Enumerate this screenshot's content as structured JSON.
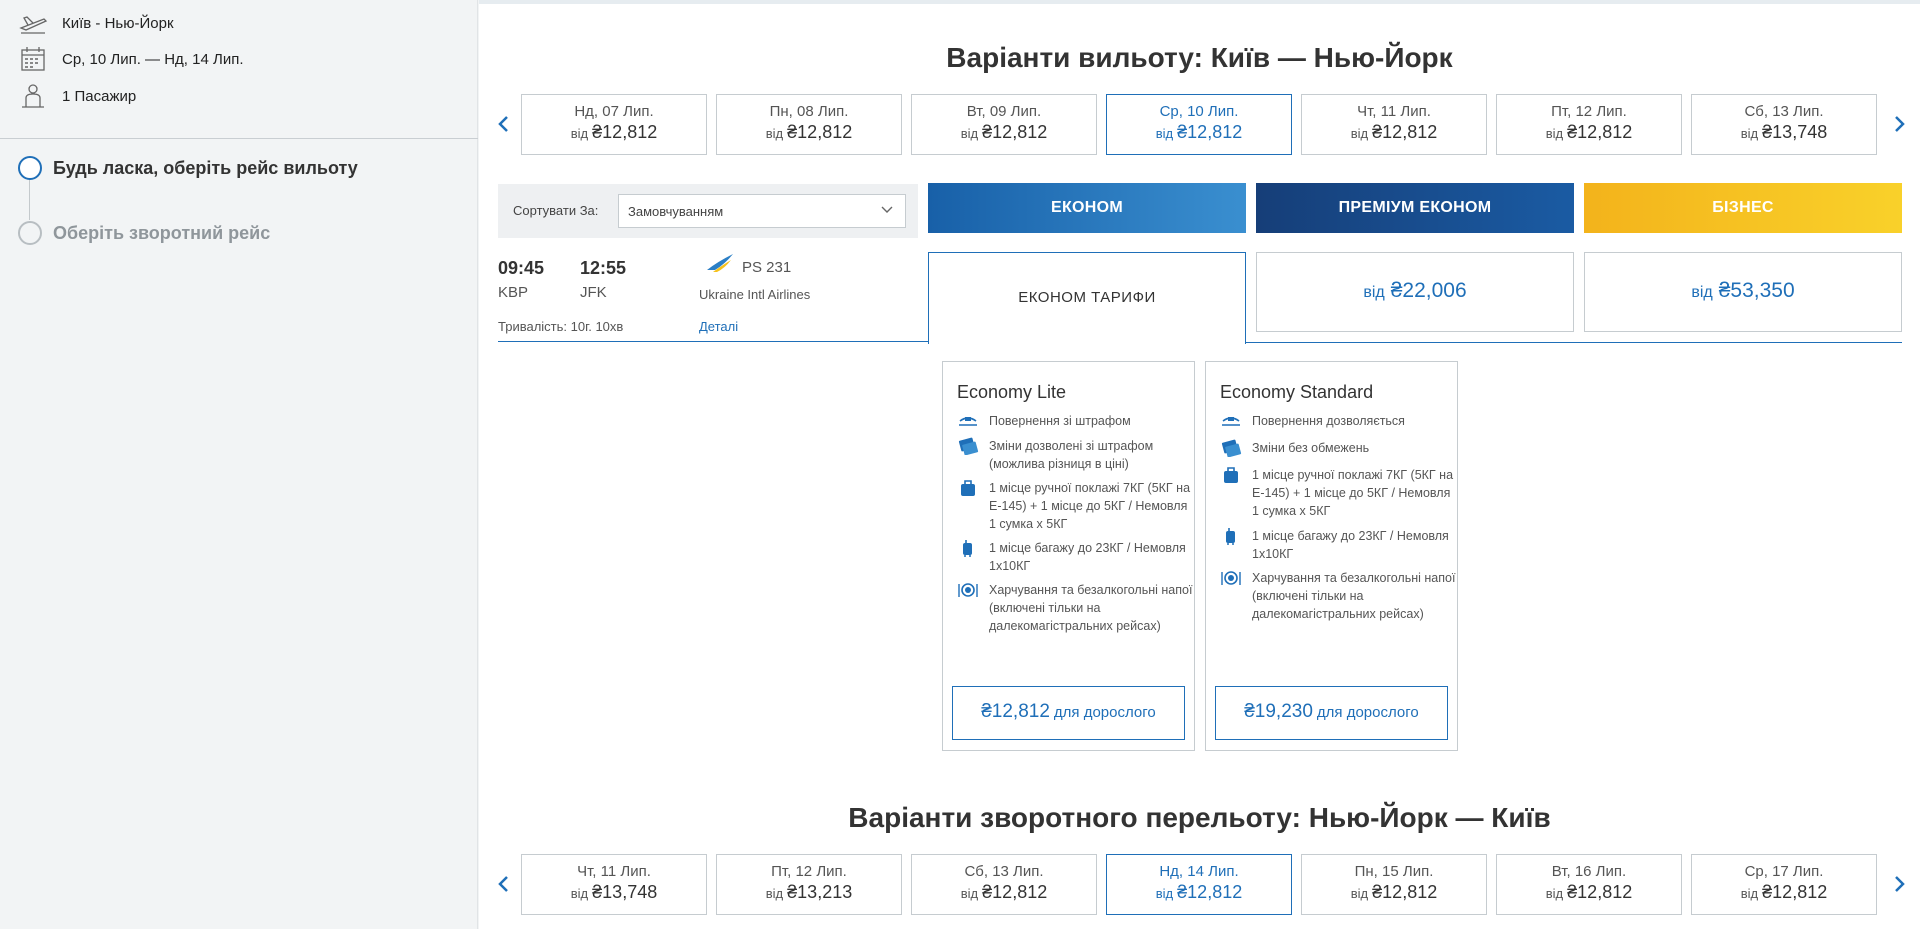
{
  "sidebar": {
    "route": "Київ - Нью-Йорк",
    "dates": "Ср, 10 Лип. — Нд, 14 Лип.",
    "passengers": "1 Пасажир",
    "steps": [
      {
        "label": "Будь ласка, оберіть рейс вильоту"
      },
      {
        "label": "Оберіть зворотний рейс"
      }
    ]
  },
  "outbound": {
    "title": "Варіанти вильоту: Київ — Нью-Йорк",
    "dates": [
      {
        "day": "Нд, 07 Лип.",
        "from": "від",
        "price": "₴12,812"
      },
      {
        "day": "Пн, 08 Лип.",
        "from": "від",
        "price": "₴12,812"
      },
      {
        "day": "Вт, 09 Лип.",
        "from": "від",
        "price": "₴12,812"
      },
      {
        "day": "Ср, 10 Лип.",
        "from": "від",
        "price": "₴12,812"
      },
      {
        "day": "Чт, 11 Лип.",
        "from": "від",
        "price": "₴12,812"
      },
      {
        "day": "Пт, 12 Лип.",
        "from": "від",
        "price": "₴12,812"
      },
      {
        "day": "Сб, 13 Лип.",
        "from": "від",
        "price": "₴13,748"
      }
    ]
  },
  "sort": {
    "label": "Сортувати За:",
    "value": "Замовчуванням"
  },
  "cabins": {
    "economy": "ЕКОНОМ",
    "premium": "ПРЕМІУМ ЕКОНОМ",
    "business": "БІЗНЕС"
  },
  "flight": {
    "dep_time": "09:45",
    "arr_time": "12:55",
    "dep_code": "KBP",
    "arr_code": "JFK",
    "flight_no": "PS 231",
    "airline": "Ukraine Intl Airlines",
    "duration": "Тривалість: 10г. 10хв",
    "details": "Деталі"
  },
  "fares_header": {
    "economy_label": "ЕКОНОМ ТАРИФИ",
    "premium_from": "від",
    "premium_price": "₴22,006",
    "business_from": "від",
    "business_price": "₴53,350"
  },
  "fare_cards": [
    {
      "title": "Economy Lite",
      "features": [
        "Повернення зі штрафом",
        "Зміни дозволені зі штрафом (можлива різниця в ціні)",
        "1 місце ручної поклажі 7КГ (5КГ на E-145) + 1 місце до 5КГ / Немовля 1 сумка x 5КГ",
        "1 місце багажу до 23КГ / Немовля 1x10КГ",
        "Харчування та безалкогольні напої (включені тільки на далекомагістральних рейсах)"
      ],
      "price": "₴12,812",
      "per": "для дорослого"
    },
    {
      "title": "Economy Standard",
      "features": [
        "Повернення дозволяється",
        "Зміни без обмежень",
        "1 місце ручної поклажі 7КГ (5КГ на E-145) + 1 місце до 5КГ / Немовля 1 сумка x 5КГ",
        "1 місце багажу до 23КГ / Немовля 1x10КГ",
        "Харчування та безалкогольні напої (включені тільки на далекомагістральних рейсах)"
      ],
      "price": "₴19,230",
      "per": "для дорослого"
    }
  ],
  "inbound": {
    "title": "Варіанти зворотного перельоту: Нью-Йорк — Київ",
    "dates": [
      {
        "day": "Чт, 11 Лип.",
        "from": "від",
        "price": "₴13,748"
      },
      {
        "day": "Пт, 12 Лип.",
        "from": "від",
        "price": "₴13,213"
      },
      {
        "day": "Сб, 13 Лип.",
        "from": "від",
        "price": "₴12,812"
      },
      {
        "day": "Нд, 14 Лип.",
        "from": "від",
        "price": "₴12,812"
      },
      {
        "day": "Пн, 15 Лип.",
        "from": "від",
        "price": "₴12,812"
      },
      {
        "day": "Вт, 16 Лип.",
        "from": "від",
        "price": "₴12,812"
      },
      {
        "day": "Ср, 17 Лип.",
        "from": "від",
        "price": "₴12,812"
      }
    ]
  },
  "colors": {
    "accent": "#1f6fb8",
    "economy": "#1860a8",
    "premium": "#163e78",
    "business": "#f3b31b"
  }
}
